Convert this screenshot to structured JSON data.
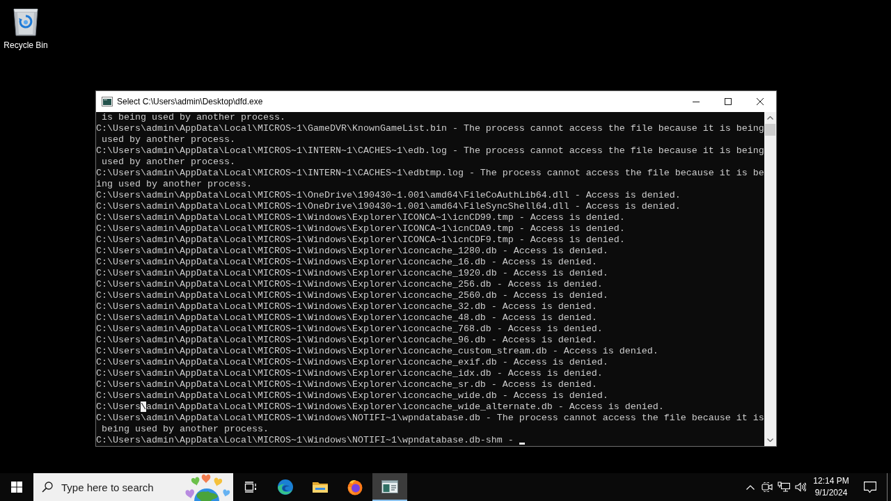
{
  "desktop": {
    "icons": [
      {
        "kind": "recycle_bin",
        "label": "Recycle Bin"
      }
    ]
  },
  "console_window": {
    "title": "Select C:\\Users\\admin\\Desktop\\dfd.exe",
    "lines": [
      {
        "kind": "text",
        "text": " is being used by another process."
      },
      {
        "kind": "text",
        "text": "C:\\Users\\admin\\AppData\\Local\\MICROS~1\\GameDVR\\KnownGameList.bin - The process cannot access the file because it is being"
      },
      {
        "kind": "text",
        "text": " used by another process."
      },
      {
        "kind": "text",
        "text": "C:\\Users\\admin\\AppData\\Local\\MICROS~1\\INTERN~1\\CACHES~1\\edb.log - The process cannot access the file because it is being"
      },
      {
        "kind": "text",
        "text": " used by another process."
      },
      {
        "kind": "text",
        "text": "C:\\Users\\admin\\AppData\\Local\\MICROS~1\\INTERN~1\\CACHES~1\\edbtmp.log - The process cannot access the file because it is be"
      },
      {
        "kind": "text",
        "text": "ing used by another process."
      },
      {
        "kind": "text",
        "text": "C:\\Users\\admin\\AppData\\Local\\MICROS~1\\OneDrive\\190430~1.001\\amd64\\FileCoAuthLib64.dll - Access is denied."
      },
      {
        "kind": "text",
        "text": "C:\\Users\\admin\\AppData\\Local\\MICROS~1\\OneDrive\\190430~1.001\\amd64\\FileSyncShell64.dll - Access is denied."
      },
      {
        "kind": "text",
        "text": "C:\\Users\\admin\\AppData\\Local\\MICROS~1\\Windows\\Explorer\\ICONCA~1\\icnCD99.tmp - Access is denied."
      },
      {
        "kind": "text",
        "text": "C:\\Users\\admin\\AppData\\Local\\MICROS~1\\Windows\\Explorer\\ICONCA~1\\icnCDA9.tmp - Access is denied."
      },
      {
        "kind": "text",
        "text": "C:\\Users\\admin\\AppData\\Local\\MICROS~1\\Windows\\Explorer\\ICONCA~1\\icnCDF9.tmp - Access is denied."
      },
      {
        "kind": "text",
        "text": "C:\\Users\\admin\\AppData\\Local\\MICROS~1\\Windows\\Explorer\\iconcache_1280.db - Access is denied."
      },
      {
        "kind": "text",
        "text": "C:\\Users\\admin\\AppData\\Local\\MICROS~1\\Windows\\Explorer\\iconcache_16.db - Access is denied."
      },
      {
        "kind": "text",
        "text": "C:\\Users\\admin\\AppData\\Local\\MICROS~1\\Windows\\Explorer\\iconcache_1920.db - Access is denied."
      },
      {
        "kind": "text",
        "text": "C:\\Users\\admin\\AppData\\Local\\MICROS~1\\Windows\\Explorer\\iconcache_256.db - Access is denied."
      },
      {
        "kind": "text",
        "text": "C:\\Users\\admin\\AppData\\Local\\MICROS~1\\Windows\\Explorer\\iconcache_2560.db - Access is denied."
      },
      {
        "kind": "text",
        "text": "C:\\Users\\admin\\AppData\\Local\\MICROS~1\\Windows\\Explorer\\iconcache_32.db - Access is denied."
      },
      {
        "kind": "text",
        "text": "C:\\Users\\admin\\AppData\\Local\\MICROS~1\\Windows\\Explorer\\iconcache_48.db - Access is denied."
      },
      {
        "kind": "text",
        "text": "C:\\Users\\admin\\AppData\\Local\\MICROS~1\\Windows\\Explorer\\iconcache_768.db - Access is denied."
      },
      {
        "kind": "text",
        "text": "C:\\Users\\admin\\AppData\\Local\\MICROS~1\\Windows\\Explorer\\iconcache_96.db - Access is denied."
      },
      {
        "kind": "text",
        "text": "C:\\Users\\admin\\AppData\\Local\\MICROS~1\\Windows\\Explorer\\iconcache_custom_stream.db - Access is denied."
      },
      {
        "kind": "text",
        "text": "C:\\Users\\admin\\AppData\\Local\\MICROS~1\\Windows\\Explorer\\iconcache_exif.db - Access is denied."
      },
      {
        "kind": "text",
        "text": "C:\\Users\\admin\\AppData\\Local\\MICROS~1\\Windows\\Explorer\\iconcache_idx.db - Access is denied."
      },
      {
        "kind": "text",
        "text": "C:\\Users\\admin\\AppData\\Local\\MICROS~1\\Windows\\Explorer\\iconcache_sr.db - Access is denied."
      },
      {
        "kind": "text",
        "text": "C:\\Users\\admin\\AppData\\Local\\MICROS~1\\Windows\\Explorer\\iconcache_wide.db - Access is denied."
      },
      {
        "kind": "marked",
        "before": "C:\\Users",
        "marked": "\\",
        "after": "admin\\AppData\\Local\\MICROS~1\\Windows\\Explorer\\iconcache_wide_alternate.db - Access is denied."
      },
      {
        "kind": "text",
        "text": "C:\\Users\\admin\\AppData\\Local\\MICROS~1\\Windows\\NOTIFI~1\\wpndatabase.db - The process cannot access the file because it is"
      },
      {
        "kind": "text",
        "text": " being used by another process."
      },
      {
        "kind": "cursor",
        "text": "C:\\Users\\admin\\AppData\\Local\\MICROS~1\\Windows\\NOTIFI~1\\wpndatabase.db-shm - "
      }
    ]
  },
  "taskbar": {
    "search": {
      "placeholder": "Type here to search"
    },
    "apps": [
      {
        "kind": "task_view",
        "selected": false
      },
      {
        "kind": "edge",
        "selected": false
      },
      {
        "kind": "file_explorer",
        "selected": false
      },
      {
        "kind": "firefox",
        "selected": false
      },
      {
        "kind": "console",
        "selected": true
      }
    ],
    "clock": {
      "time": "12:14 PM",
      "date": "9/1/2024"
    }
  }
}
